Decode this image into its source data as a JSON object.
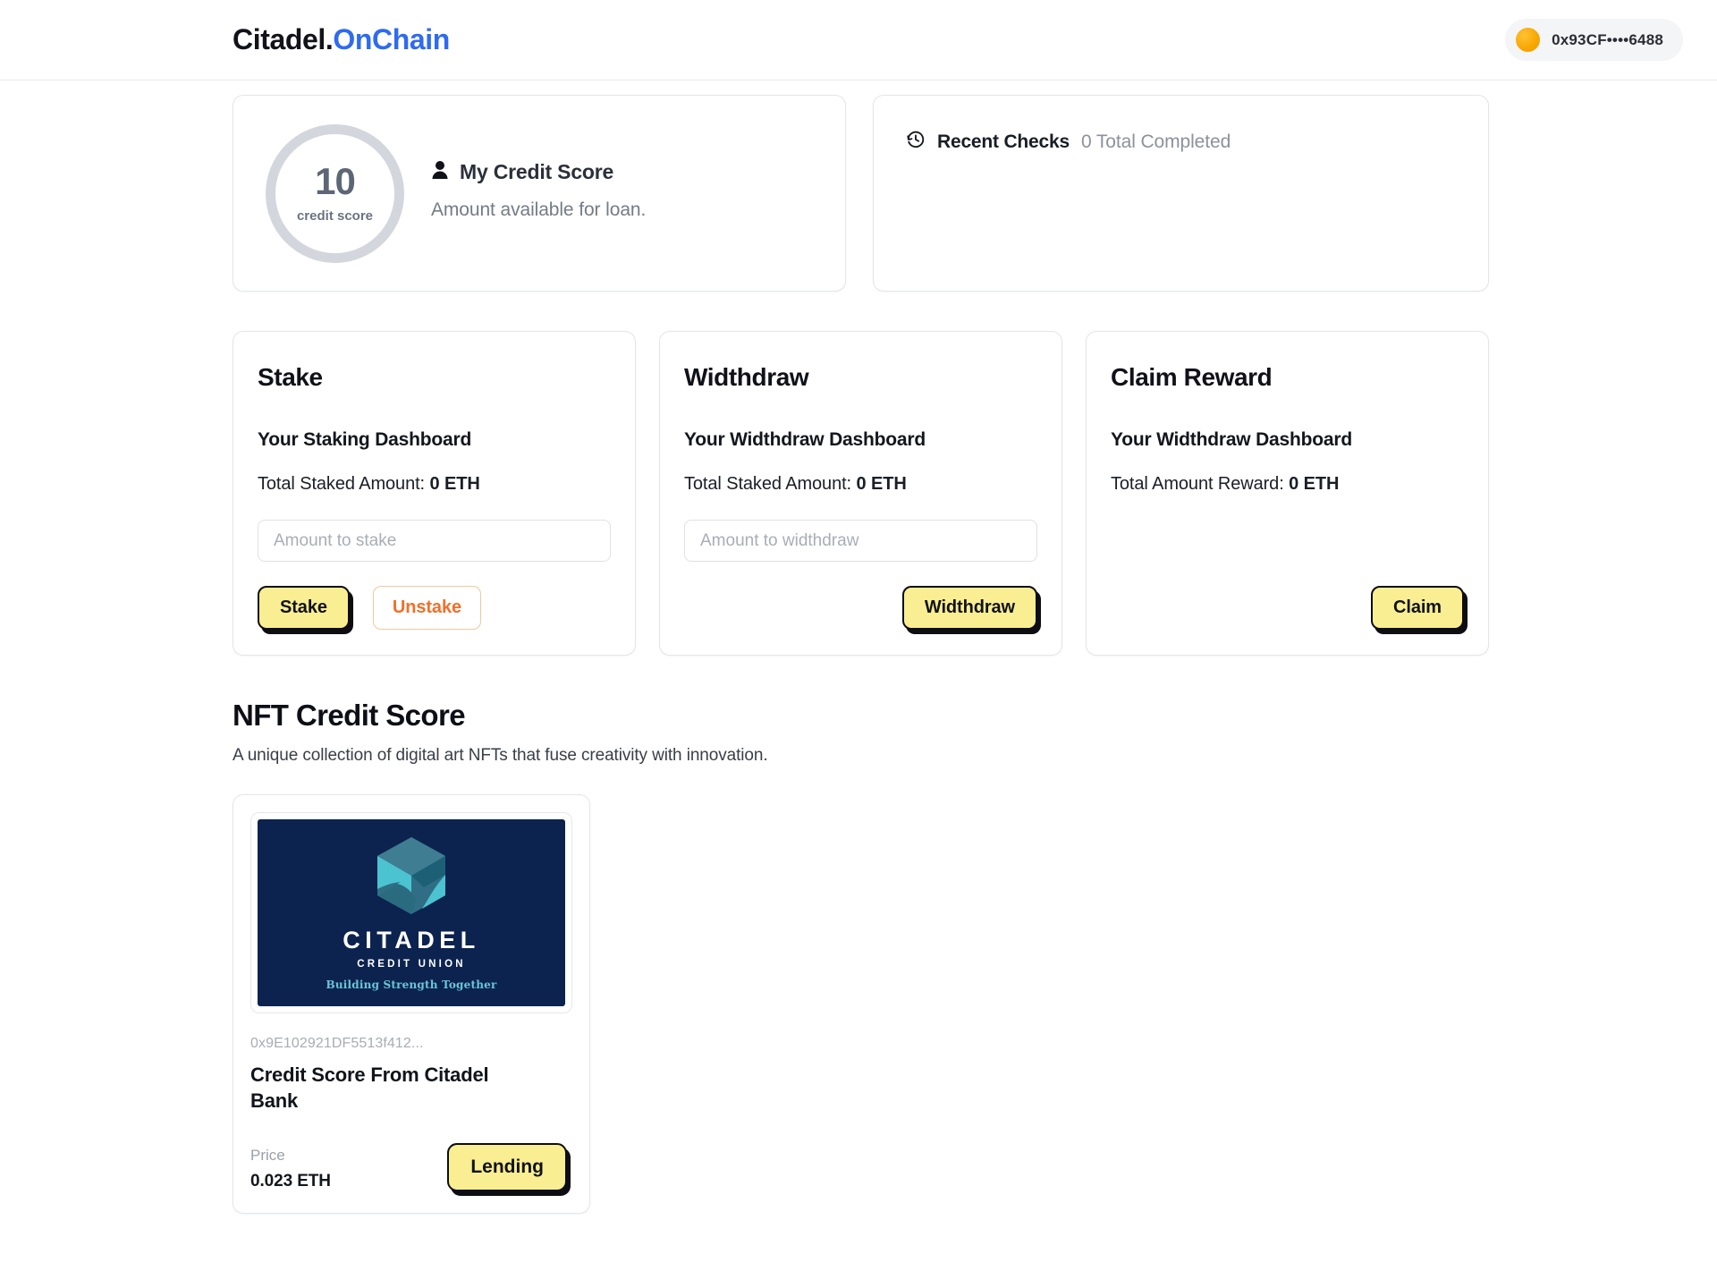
{
  "header": {
    "brand_primary": "Citadel.",
    "brand_accent": "OnChain",
    "wallet_address": "0x93CF••••6488",
    "wallet_icon": "wallet-avatar-icon"
  },
  "credit_score": {
    "value": "10",
    "ring_label": "credit score",
    "icon": "person-icon",
    "title": "My Credit Score",
    "subtitle": "Amount available for loan."
  },
  "recent_checks": {
    "icon": "history-clock-icon",
    "title": "Recent Checks",
    "count_text": "0 Total Completed"
  },
  "actions": [
    {
      "title": "Stake",
      "subtitle": "Your Staking Dashboard",
      "amount_label": "Total Staked Amount:",
      "amount_value": "0 ETH",
      "input_placeholder": "Amount to stake",
      "input_value": "",
      "primary_button": "Stake",
      "secondary_button": "Unstake"
    },
    {
      "title": "Widthdraw",
      "subtitle": "Your Widthdraw Dashboard",
      "amount_label": "Total Staked Amount:",
      "amount_value": "0 ETH",
      "input_placeholder": "Amount to widthdraw",
      "input_value": "",
      "primary_button": "Widthdraw"
    },
    {
      "title": "Claim Reward",
      "subtitle": "Your Widthdraw Dashboard",
      "amount_label": "Total Amount Reward:",
      "amount_value": "0 ETH",
      "primary_button": "Claim"
    }
  ],
  "nft_section": {
    "heading": "NFT Credit Score",
    "description": "A unique collection of digital art NFTs that fuse creativity with innovation.",
    "items": [
      {
        "art": {
          "logo": "citadel-hexagon-logo",
          "wordmark": "CITADEL",
          "sub_wordmark": "CREDIT UNION",
          "tagline": "Building Strength Together"
        },
        "address": "0x9E102921DF5513f412...",
        "name": "Credit Score From Citadel Bank",
        "price_label": "Price",
        "price_value": "0.023 ETH",
        "action_button": "Lending"
      }
    ]
  },
  "colors": {
    "accent_blue": "#2f6bf0",
    "button_yellow": "#faee92",
    "orange": "#f0702a",
    "nft_navy": "#0c2350",
    "nft_teal": "#4cc3d0",
    "wallet_orange": "#f7a600"
  }
}
